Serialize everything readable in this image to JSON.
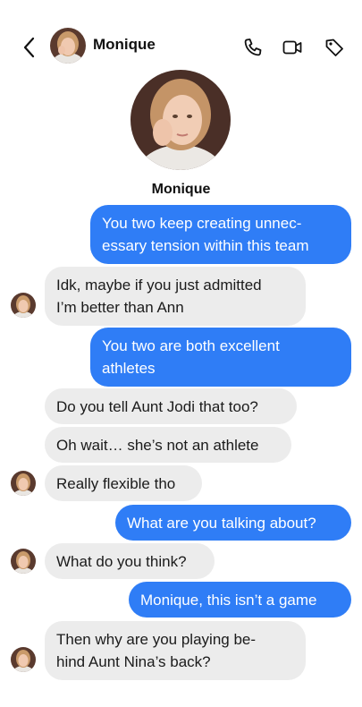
{
  "contact": {
    "name": "Monique"
  },
  "header": {
    "back_icon": "chevron-left-icon",
    "call_icon": "phone-icon",
    "video_icon": "video-camera-icon",
    "tag_icon": "tag-icon"
  },
  "colors": {
    "outgoing": "#2f7df6",
    "incoming": "#ececec",
    "background": "#ffffff"
  },
  "messages": [
    {
      "direction": "outgoing",
      "lines": [
        "You two keep creating unnec-",
        "essary tension within this team"
      ]
    },
    {
      "direction": "incoming",
      "lines": [
        "Idk, maybe if you just admitted",
        "I’m better than Ann"
      ]
    },
    {
      "direction": "outgoing",
      "lines": [
        "You two are both excellent",
        "athletes"
      ]
    },
    {
      "direction": "incoming",
      "lines": [
        "Do you tell Aunt Jodi that too?"
      ]
    },
    {
      "direction": "incoming",
      "lines": [
        "Oh wait… she’s not an athlete"
      ]
    },
    {
      "direction": "incoming",
      "lines": [
        "Really flexible tho"
      ]
    },
    {
      "direction": "outgoing",
      "lines": [
        "What are you talking about?"
      ]
    },
    {
      "direction": "incoming",
      "lines": [
        "What do you think?"
      ]
    },
    {
      "direction": "outgoing",
      "lines": [
        "Monique, this isn’t a game"
      ]
    },
    {
      "direction": "incoming",
      "lines": [
        "Then why are you playing be-",
        "hind Aunt Nina’s back?"
      ]
    }
  ]
}
